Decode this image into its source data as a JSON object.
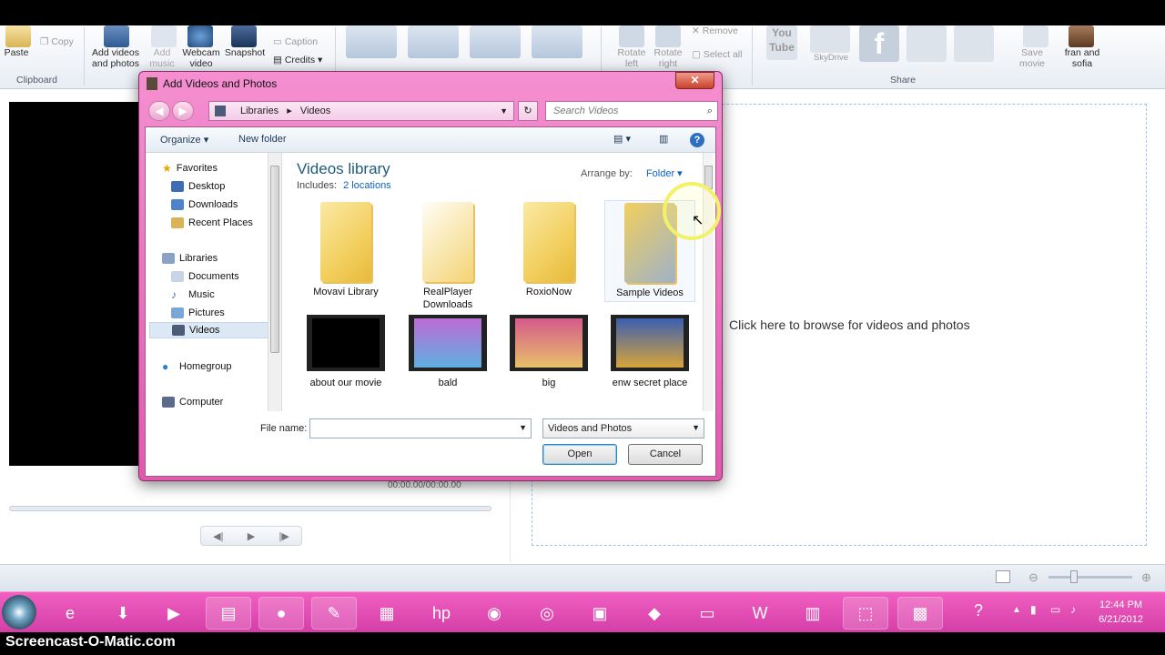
{
  "ribbon": {
    "clipboard": {
      "paste": "Paste",
      "copy": "Copy",
      "group": "Clipboard"
    },
    "add": {
      "add_videos": "Add videos and photos",
      "add_music": "Add music",
      "webcam": "Webcam video",
      "snapshot": "Snapshot",
      "caption": "Caption",
      "credits": "Credits"
    },
    "edit": {
      "rotate_left": "Rotate left",
      "rotate_right": "Rotate right",
      "remove": "Remove",
      "select_all": "Select all"
    },
    "share": {
      "skydrive": "SkyDrive",
      "save_movie": "Save movie",
      "user": "fran and sofia",
      "group": "Share"
    }
  },
  "workspace": {
    "browse_text": "Click here to browse for videos and photos",
    "timecode": "00:00.00/00:00.00"
  },
  "dialog": {
    "title": "Add Videos and Photos",
    "address": {
      "crumb1": "Libraries",
      "sep": "▸",
      "crumb2": "Videos"
    },
    "search_placeholder": "Search Videos",
    "toolbar": {
      "organize": "Organize",
      "new_folder": "New folder"
    },
    "nav": {
      "favorites": "Favorites",
      "desktop": "Desktop",
      "downloads": "Downloads",
      "recent": "Recent Places",
      "libraries": "Libraries",
      "documents": "Documents",
      "music": "Music",
      "pictures": "Pictures",
      "videos": "Videos",
      "homegroup": "Homegroup",
      "computer": "Computer"
    },
    "library": {
      "title": "Videos library",
      "includes_label": "Includes:",
      "includes_link": "2 locations",
      "arrange_label": "Arrange by:",
      "arrange_value": "Folder"
    },
    "folders": [
      "Movavi Library",
      "RealPlayer Downloads",
      "RoxioNow",
      "Sample Videos"
    ],
    "videos": [
      "about our movie",
      "bald",
      "big",
      "enw secret place"
    ],
    "filename_label": "File name:",
    "filename_value": "",
    "filter": "Videos and Photos",
    "open": "Open",
    "cancel": "Cancel"
  },
  "taskbar": {
    "time": "12:44 PM",
    "date": "6/21/2012"
  },
  "watermark": "Screencast-O-Matic.com",
  "colors": {
    "taskbar": "#d53ea9",
    "dialog_frame": "#e05aae",
    "link": "#0b62c4"
  }
}
